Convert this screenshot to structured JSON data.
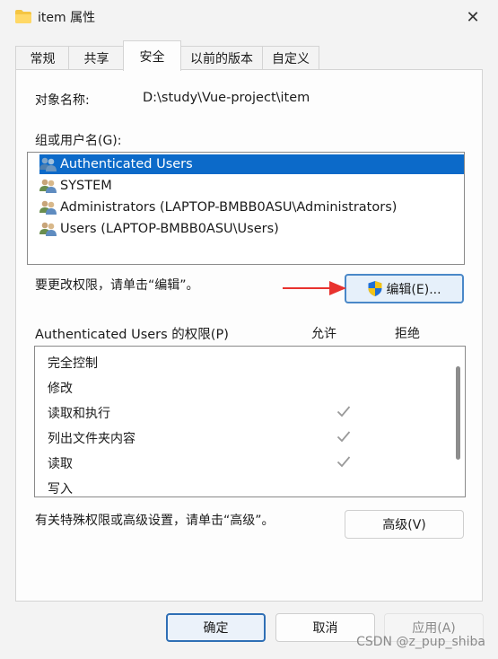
{
  "window": {
    "title": "item 属性",
    "close_icon": "✕"
  },
  "tabs": [
    {
      "label": "常规"
    },
    {
      "label": "共享"
    },
    {
      "label": "安全",
      "active": true
    },
    {
      "label": "以前的版本"
    },
    {
      "label": "自定义"
    }
  ],
  "object": {
    "label": "对象名称:",
    "value": "D:\\study\\Vue-project\\item"
  },
  "groups": {
    "label": "组或用户名(G):",
    "items": [
      {
        "name": "Authenticated Users",
        "selected": true
      },
      {
        "name": "SYSTEM"
      },
      {
        "name": "Administrators (LAPTOP-BMBB0ASU\\Administrators)"
      },
      {
        "name": "Users (LAPTOP-BMBB0ASU\\Users)"
      }
    ]
  },
  "change_hint": "要更改权限，请单击“编辑”。",
  "edit_button": "编辑(E)...",
  "permissions": {
    "title": "Authenticated Users 的权限(P)",
    "allow_header": "允许",
    "deny_header": "拒绝",
    "rows": [
      {
        "name": "完全控制",
        "allow": false
      },
      {
        "name": "修改",
        "allow": false
      },
      {
        "name": "读取和执行",
        "allow": true
      },
      {
        "name": "列出文件夹内容",
        "allow": true
      },
      {
        "name": "读取",
        "allow": true
      },
      {
        "name": "写入",
        "allow": false
      }
    ]
  },
  "advanced_hint": "有关特殊权限或高级设置，请单击“高级”。",
  "advanced_button": "高级(V)",
  "footer": {
    "ok": "确定",
    "cancel": "取消",
    "apply": "应用(A)"
  },
  "watermark": "CSDN @z_pup_shiba",
  "colors": {
    "selection": "#0c6ac9",
    "arrow": "#e8322e",
    "shield_blue": "#1f6fd6",
    "shield_yellow": "#f3c316"
  }
}
